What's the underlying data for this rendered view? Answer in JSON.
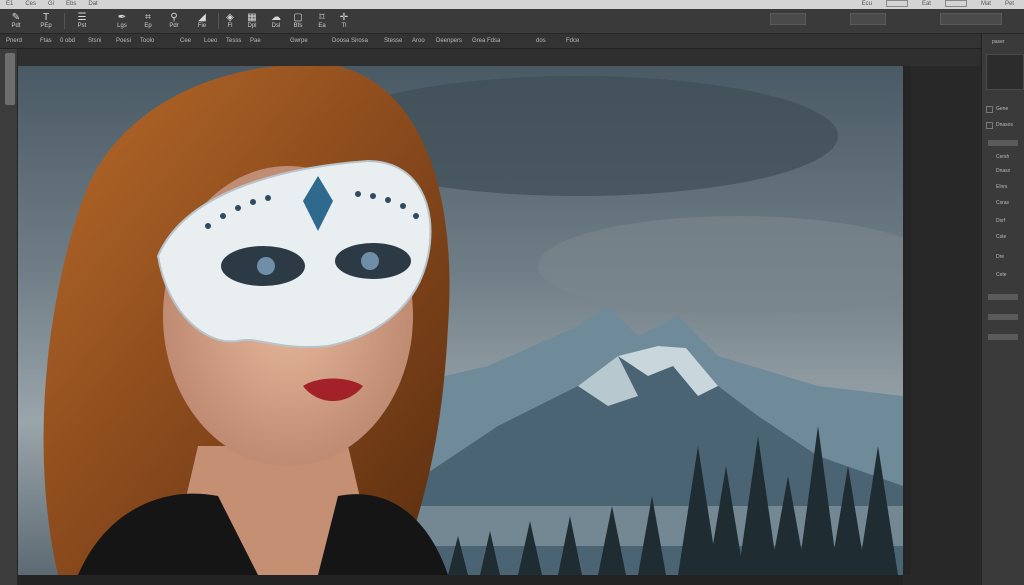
{
  "titlebar": {
    "menu": [
      "E1",
      "Ces",
      "Gi",
      "Ebs",
      "Dat"
    ],
    "right": [
      "Ecu",
      "Eat",
      "Mat",
      "Pet"
    ]
  },
  "toolbar": {
    "tools": [
      {
        "icon": "brush-icon",
        "label": "Pdt"
      },
      {
        "icon": "text-icon",
        "label": "PEp"
      },
      {
        "icon": "layers-icon",
        "label": "Pst"
      },
      {
        "icon": "pen-icon",
        "label": "Lgs"
      },
      {
        "icon": "crop-icon",
        "label": "Ep"
      },
      {
        "icon": "stamp-icon",
        "label": "Pdr"
      },
      {
        "icon": "shape-icon",
        "label": "Fie"
      },
      {
        "icon": "eraser-icon",
        "label": "Fl"
      },
      {
        "icon": "gradient-icon",
        "label": "Dpl"
      },
      {
        "icon": "dodge-icon",
        "label": "Dsl"
      },
      {
        "icon": "marquee-icon",
        "label": "Bfs"
      },
      {
        "icon": "lasso-icon",
        "label": "Ea"
      },
      {
        "icon": "move-icon",
        "label": "Tl"
      }
    ]
  },
  "options": [
    "Pnerd",
    "Ftas",
    "0 obd",
    "Stsni",
    "Poesi",
    "Toolo",
    "Cee",
    "Loeo",
    "Tesss",
    "Pae",
    "Gwrpe",
    "Doosa Sirosa",
    "Stesse",
    "Aroo",
    "Deenpers",
    "Grea Fdsa",
    "dos",
    "Fdce"
  ],
  "panel": {
    "header": "paser",
    "items": [
      "Gene",
      "Dnasos",
      "Cersh",
      "Dnasx",
      "Elnrs",
      "Csras",
      "Dsrf",
      "Cste",
      "Dre",
      "Cete"
    ]
  },
  "colors": {
    "workspace": "#2b2b2b",
    "toolbar": "#3a3a3a",
    "titlebar": "#d4d4d4"
  }
}
